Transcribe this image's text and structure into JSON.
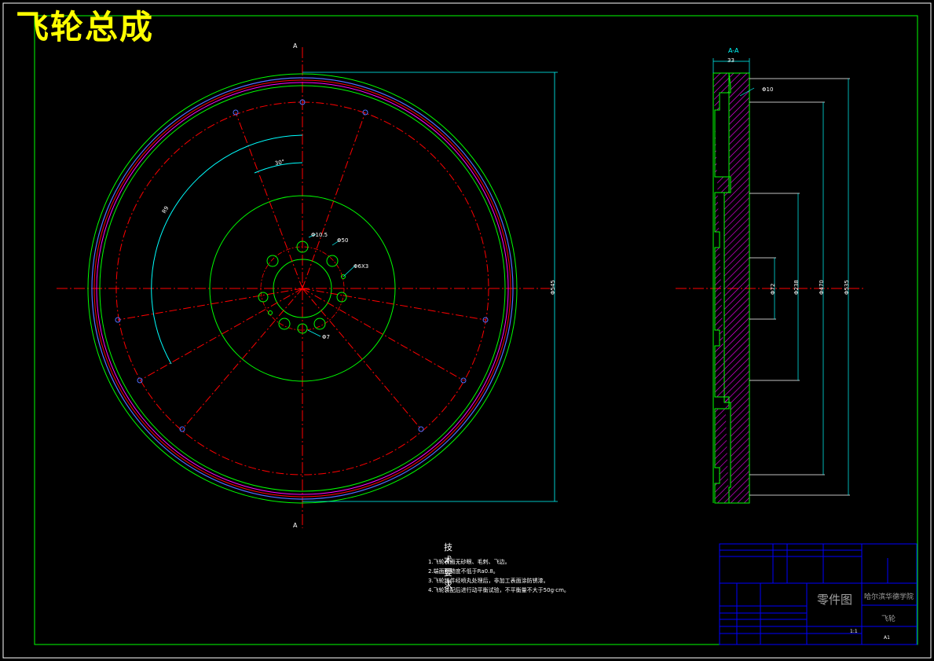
{
  "title": "飞轮总成",
  "section_label": "A-A",
  "section_marks": {
    "top": "A",
    "bottom": "A"
  },
  "dimensions": {
    "front_outer_dia": "Φ545",
    "angle": "30°",
    "radius_label": "R9",
    "hole_small_1": "Φ10.5",
    "hole_small_2": "Φ50",
    "hole_small_3": "Φ6X3",
    "hole_small_4": "Φ7",
    "side_top_width": "33",
    "side_hole": "Φ10",
    "side_d1": "Φ72",
    "side_d2": "Φ238",
    "side_d3": "Φ470",
    "side_d4": "Φ535"
  },
  "tech_notes": {
    "heading": "技术要求",
    "lines": [
      "1.飞轮表面无砂眼、毛刺、飞边。",
      "2.端面粗糙度不低于Ra0.8。",
      "3.飞轮铸件经喷丸处理后，非加工表面涂防锈漆。",
      "4.飞轮装配后进行动平衡试验，不平衡量不大于50g·cm。"
    ]
  },
  "title_block": {
    "drawing_type": "零件图",
    "school": "哈尔滨华德学院",
    "part_name": "飞轮",
    "scale": "1:1",
    "code": "A1"
  },
  "colors": {
    "background": "#000000",
    "frame": "#00ff00",
    "center_line": "#ff0000",
    "dimension": "#00ffff",
    "outline": "#00ff00",
    "hatch": "#ff00ff",
    "title": "#ffff00",
    "title_block": "#0000ff"
  }
}
